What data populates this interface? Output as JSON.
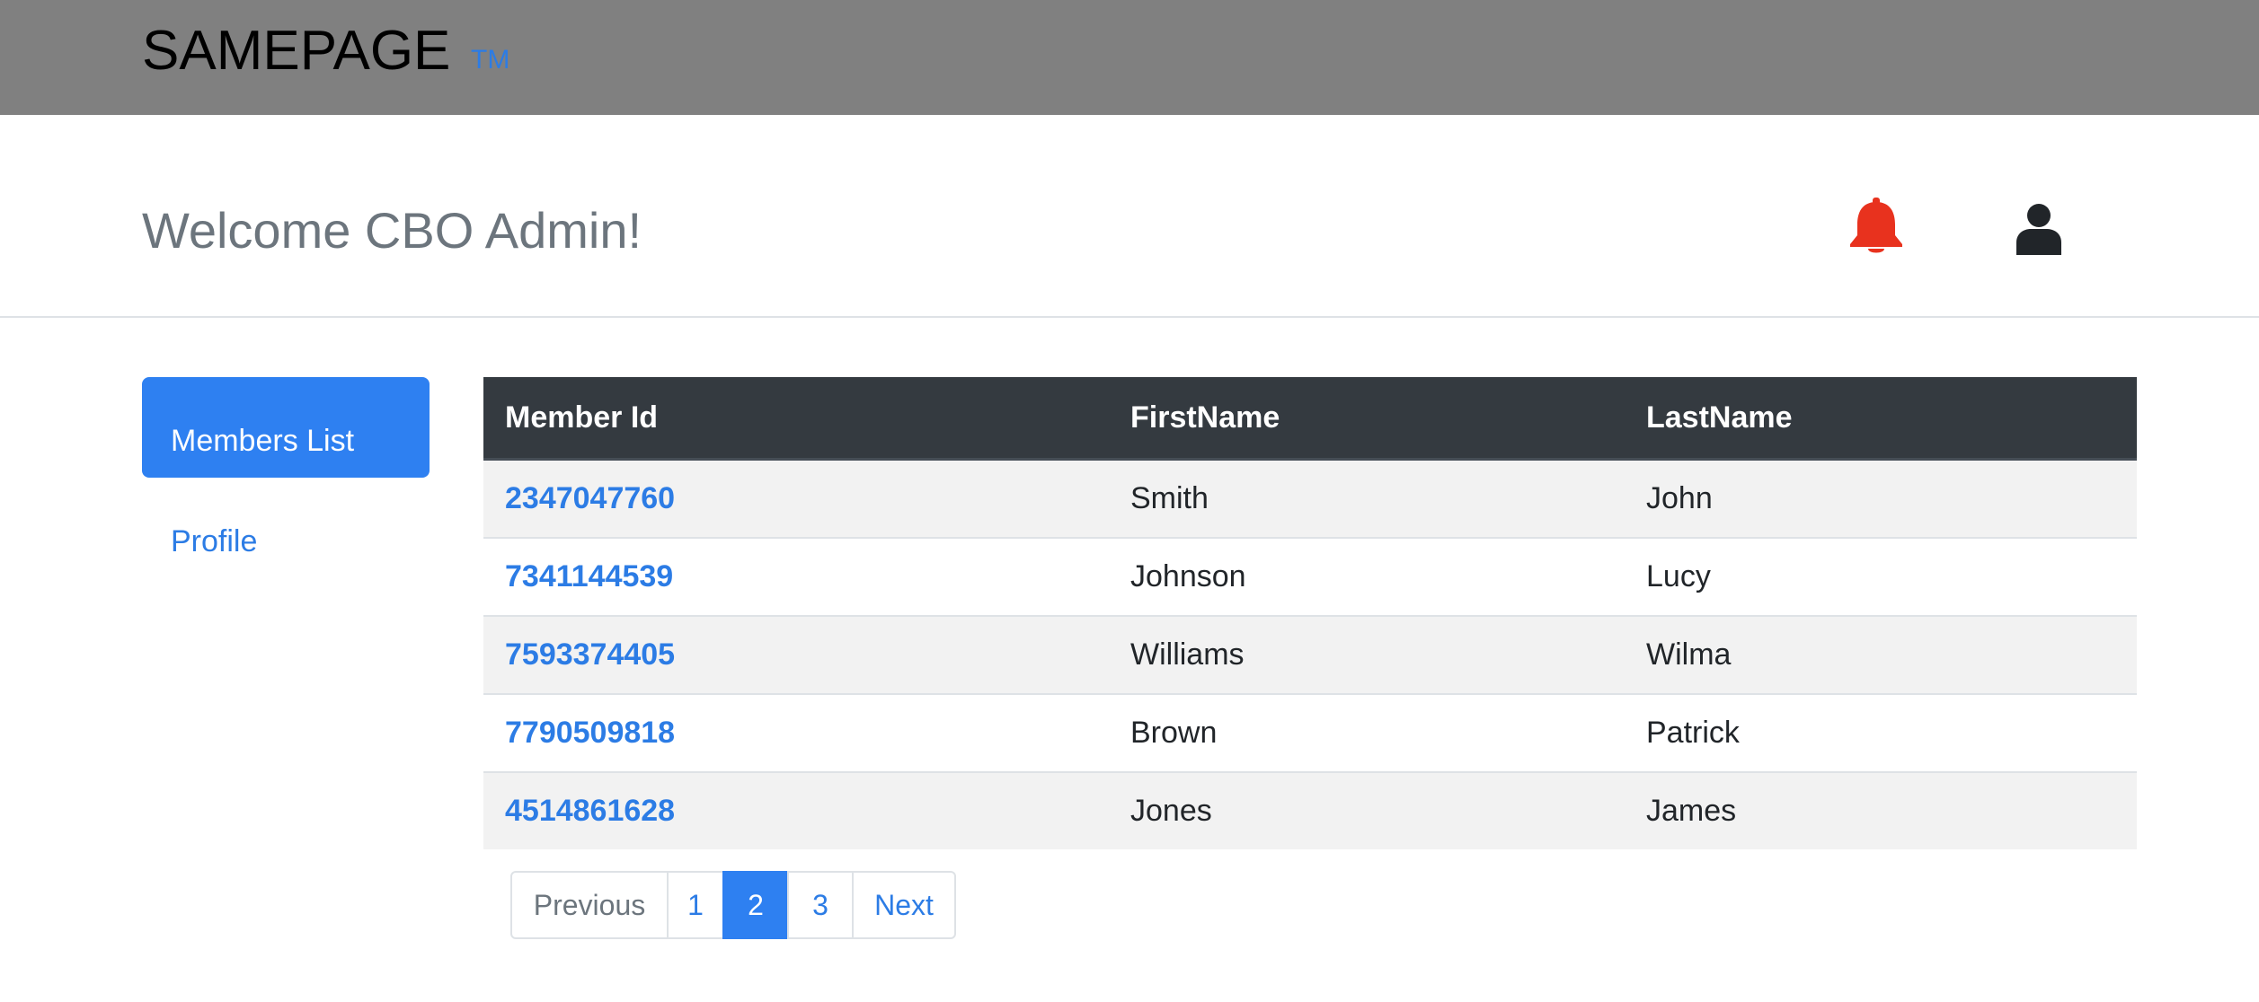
{
  "brand": {
    "name": "SAMEPAGE",
    "trademark": "TM"
  },
  "header": {
    "welcome": "Welcome CBO Admin!",
    "icons": {
      "notifications": "bell-icon",
      "account": "user-icon"
    },
    "colors": {
      "bell": "#e8321e",
      "user": "#212529"
    }
  },
  "sidebar": {
    "items": [
      {
        "label": "Members List",
        "active": true
      },
      {
        "label": "Profile",
        "active": false
      }
    ]
  },
  "table": {
    "headers": [
      "Member Id",
      "FirstName",
      "LastName"
    ],
    "rows": [
      {
        "member_id": "2347047760",
        "first_name": "Smith",
        "last_name": "John"
      },
      {
        "member_id": "7341144539",
        "first_name": "Johnson",
        "last_name": "Lucy"
      },
      {
        "member_id": "7593374405",
        "first_name": "Williams",
        "last_name": "Wilma"
      },
      {
        "member_id": "7790509818",
        "first_name": "Brown",
        "last_name": "Patrick"
      },
      {
        "member_id": "4514861628",
        "first_name": "Jones",
        "last_name": "James"
      }
    ]
  },
  "pagination": {
    "previous": "Previous",
    "pages": [
      "1",
      "2",
      "3"
    ],
    "current": "2",
    "next": "Next"
  },
  "colors": {
    "topbar": "#808080",
    "accent": "#2e80f1",
    "link": "#2c7ce5",
    "table_header": "#343a40",
    "stripe": "#f2f2f2"
  }
}
